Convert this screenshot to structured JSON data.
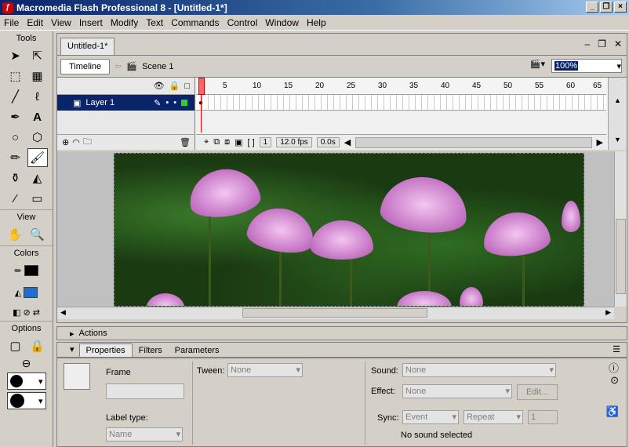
{
  "window": {
    "title": "Macromedia Flash Professional 8 - [Untitled-1*]"
  },
  "menu": [
    "File",
    "Edit",
    "View",
    "Insert",
    "Modify",
    "Text",
    "Commands",
    "Control",
    "Window",
    "Help"
  ],
  "tools": {
    "title": "Tools",
    "view_label": "View",
    "colors_label": "Colors",
    "options_label": "Options"
  },
  "document": {
    "tab": "Untitled-1*",
    "timeline_button": "Timeline",
    "scene": "Scene 1",
    "zoom": "100%"
  },
  "timeline": {
    "layer_name": "Layer 1",
    "frame_numbers": [
      "1",
      "5",
      "10",
      "15",
      "20",
      "25",
      "30",
      "35",
      "40",
      "45",
      "50",
      "55",
      "60",
      "65"
    ],
    "current_frame": "1",
    "fps": "12.0 fps",
    "time": "0.0s"
  },
  "panels": {
    "actions": "Actions",
    "tabs": [
      "Properties",
      "Filters",
      "Parameters"
    ]
  },
  "properties": {
    "frame_label": "Frame",
    "tween_label": "Tween:",
    "tween_value": "None",
    "sound_label": "Sound:",
    "sound_value": "None",
    "effect_label": "Effect:",
    "effect_value": "None",
    "edit_button": "Edit...",
    "sync_label": "Sync:",
    "sync_value": "Event",
    "repeat_value": "Repeat",
    "repeat_count": "1",
    "label_type_label": "Label type:",
    "label_type_value": "Name",
    "status": "No sound selected"
  }
}
